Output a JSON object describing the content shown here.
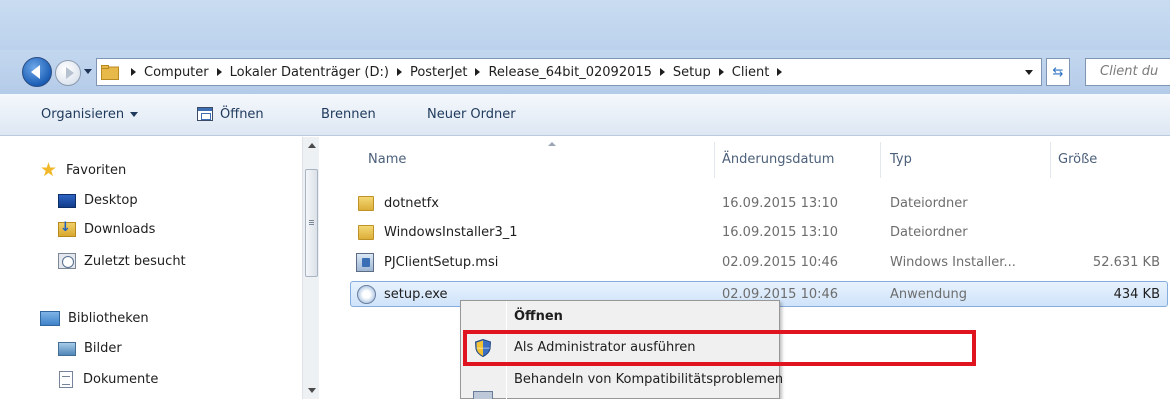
{
  "addressbar": {
    "crumbs": [
      "Computer",
      "Lokaler Datenträger (D:)",
      "PosterJet",
      "Release_64bit_02092015",
      "Setup",
      "Client"
    ],
    "search_placeholder": "Client du"
  },
  "toolbar": {
    "organize": "Organisieren",
    "open": "Öffnen",
    "burn": "Brennen",
    "new_folder": "Neuer Ordner"
  },
  "sidebar": {
    "favorites": "Favoriten",
    "desktop": "Desktop",
    "downloads": "Downloads",
    "recent": "Zuletzt besucht",
    "libraries": "Bibliotheken",
    "pictures": "Bilder",
    "documents": "Dokumente"
  },
  "columns": {
    "name": "Name",
    "date": "Änderungsdatum",
    "type": "Typ",
    "size": "Größe"
  },
  "files": [
    {
      "name": "dotnetfx",
      "date": "16.09.2015 13:10",
      "type": "Dateiordner",
      "size": ""
    },
    {
      "name": "WindowsInstaller3_1",
      "date": "16.09.2015 13:10",
      "type": "Dateiordner",
      "size": ""
    },
    {
      "name": "PJClientSetup.msi",
      "date": "02.09.2015 10:46",
      "type": "Windows Installer...",
      "size": "52.631 KB"
    },
    {
      "name": "setup.exe",
      "date": "02.09.2015 10:46",
      "type": "Anwendung",
      "size": "434 KB"
    }
  ],
  "context_menu": {
    "open": "Öffnen",
    "run_as_admin": "Als Administrator ausführen",
    "compat": "Behandeln von Kompatibilitätsproblemen"
  },
  "colors": {
    "highlight": "#e0141e",
    "selection": "#cfe3fa"
  }
}
